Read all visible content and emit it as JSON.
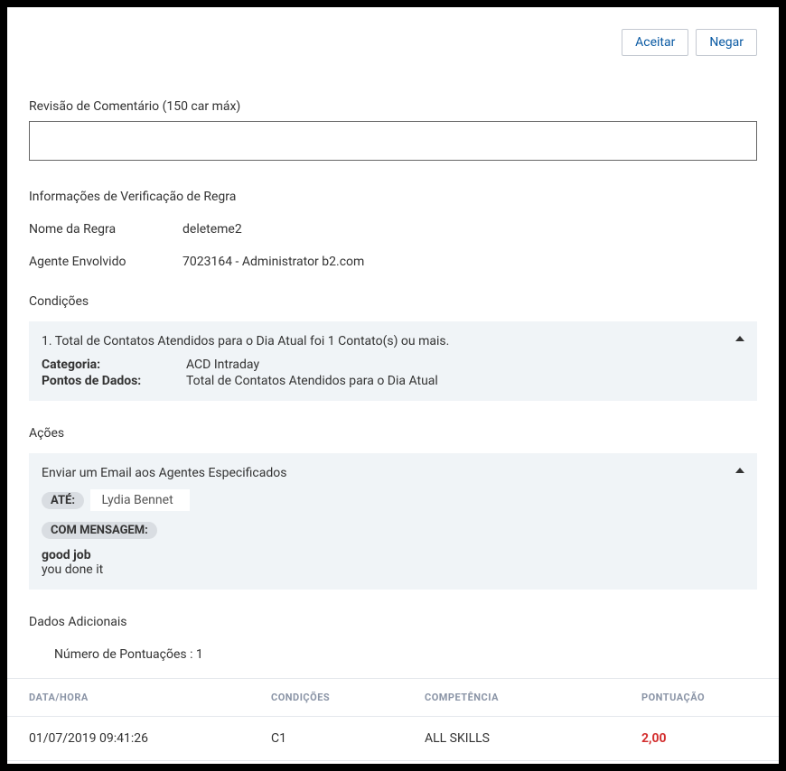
{
  "actions": {
    "accept": "Aceitar",
    "deny": "Negar"
  },
  "comment": {
    "label": "Revisão de Comentário (150 car máx)",
    "value": ""
  },
  "ruleInfo": {
    "heading": "Informações de Verificação de Regra",
    "nameLabel": "Nome da Regra",
    "nameValue": "deleteme2",
    "agentLabel": "Agente Envolvido",
    "agentValue": "7023164 - Administrator b2.com"
  },
  "conditions": {
    "heading": "Condições",
    "title": "1. Total de Contatos Atendidos para o Dia Atual foi 1 Contato(s) ou mais.",
    "categoryLabel": "Categoria:",
    "categoryValue": "ACD Intraday",
    "dataPointsLabel": "Pontos de Dados:",
    "dataPointsValue": "Total de Contatos Atendidos para o Dia Atual"
  },
  "ruleActions": {
    "heading": "Ações",
    "title": "Enviar um Email aos Agentes Especificados",
    "toLabel": "ATÉ:",
    "recipient": "Lydia Bennet",
    "withMessageLabel": "COM MENSAGEM:",
    "msgLine1": "good job",
    "msgLine2": "you done it"
  },
  "additional": {
    "heading": "Dados Adicionais",
    "scoreCount": "Número de Pontuações : 1"
  },
  "table": {
    "headers": {
      "datetime": "DATA/HORA",
      "conditions": "CONDIÇÕES",
      "skill": "COMPETÊNCIA",
      "score": "PONTUAÇÃO"
    },
    "rows": [
      {
        "datetime": "01/07/2019 09:41:26",
        "conditions": "C1",
        "skill": "ALL SKILLS",
        "score": "2,00"
      }
    ]
  }
}
